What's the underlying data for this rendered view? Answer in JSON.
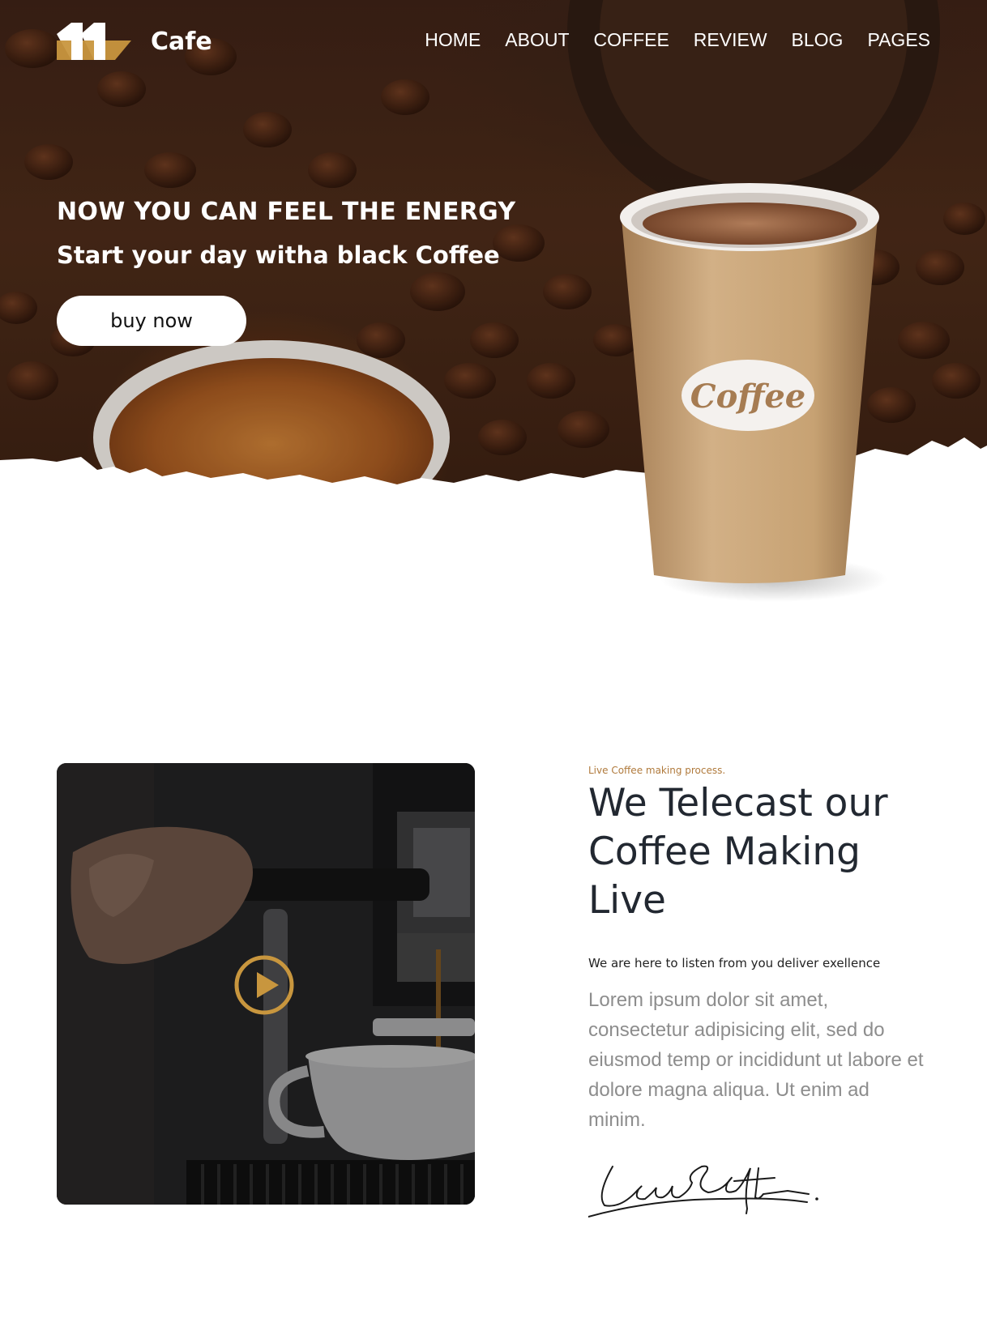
{
  "brand": {
    "name": "Cafe"
  },
  "nav": {
    "items": [
      "HOME",
      "ABOUT",
      "COFFEE",
      "REVIEW",
      "BLOG",
      "PAGES"
    ]
  },
  "hero": {
    "headline": "NOW YOU CAN FEEL THE ENERGY",
    "subline": "Start your day witha black Coffee",
    "cta_label": "buy now",
    "cup_label": "Coffee"
  },
  "live": {
    "kicker": "Live Coffee making process.",
    "title": "We Telecast our Coffee Making Live",
    "tagline": "We are here to listen from you deliver exellence",
    "body": "Lorem ipsum dolor sit amet, consectetur adipisicing elit, sed do eiusmod temp or incididunt ut labore et dolore magna aliqua. Ut enim ad minim.",
    "signature": "LaraCroft"
  },
  "colors": {
    "accent": "#c8963e",
    "heading": "#222831",
    "muted": "#8d8d8d",
    "kicker": "#b07a3c"
  },
  "icons": {
    "logo": "brand-logo-icon",
    "play": "play-circle-icon"
  }
}
